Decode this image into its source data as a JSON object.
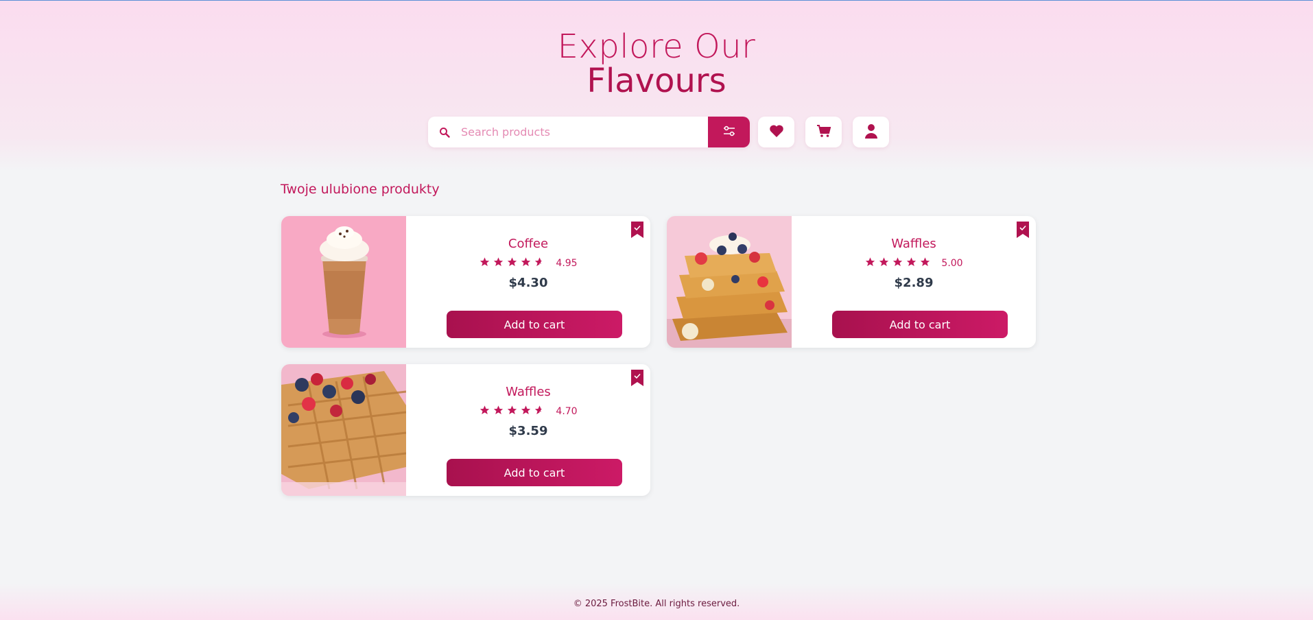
{
  "hero": {
    "line1": "Explore Our",
    "line2": "Flavours"
  },
  "search": {
    "placeholder": "Search products",
    "value": ""
  },
  "section": {
    "title": "Twoje ulubione produkty"
  },
  "products": [
    {
      "name": "Coffee",
      "rating": "4.95",
      "stars": 4.5,
      "price": "$4.30",
      "button": "Add to cart",
      "image": "iced-coffee"
    },
    {
      "name": "Waffles",
      "rating": "5.00",
      "stars": 5,
      "price": "$2.89",
      "button": "Add to cart",
      "image": "waffle-stack"
    },
    {
      "name": "Waffles",
      "rating": "4.70",
      "stars": 4.5,
      "price": "$3.59",
      "button": "Add to cart",
      "image": "waffles-berries"
    }
  ],
  "footer": {
    "text": "© 2025 FrostBite. All rights reserved."
  },
  "colors": {
    "accent": "#c2185b",
    "accent_dark": "#a8114e",
    "price": "#2f3a4a"
  }
}
